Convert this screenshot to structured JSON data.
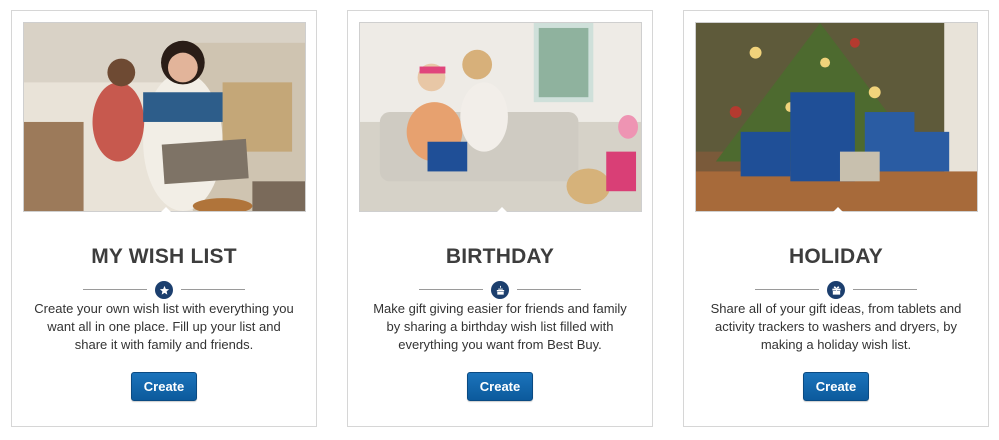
{
  "cards": [
    {
      "title": "MY WISH LIST",
      "description": "Create your own wish list with everything you want all in one place. Fill up your list and share it with family and friends.",
      "button_label": "Create",
      "icon": "star-icon"
    },
    {
      "title": "BIRTHDAY",
      "description": "Make gift giving easier for friends and family by sharing a birthday wish list filled with everything you want from Best Buy.",
      "button_label": "Create",
      "icon": "cake-icon"
    },
    {
      "title": "HOLIDAY",
      "description": "Share all of your gift ideas, from tablets and activity trackers to washers and dryers, by making a holiday wish list.",
      "button_label": "Create",
      "icon": "gift-icon"
    }
  ],
  "colors": {
    "button": "#0c5a9c",
    "badge": "#1c3f6e",
    "title": "#3d3d3d"
  }
}
